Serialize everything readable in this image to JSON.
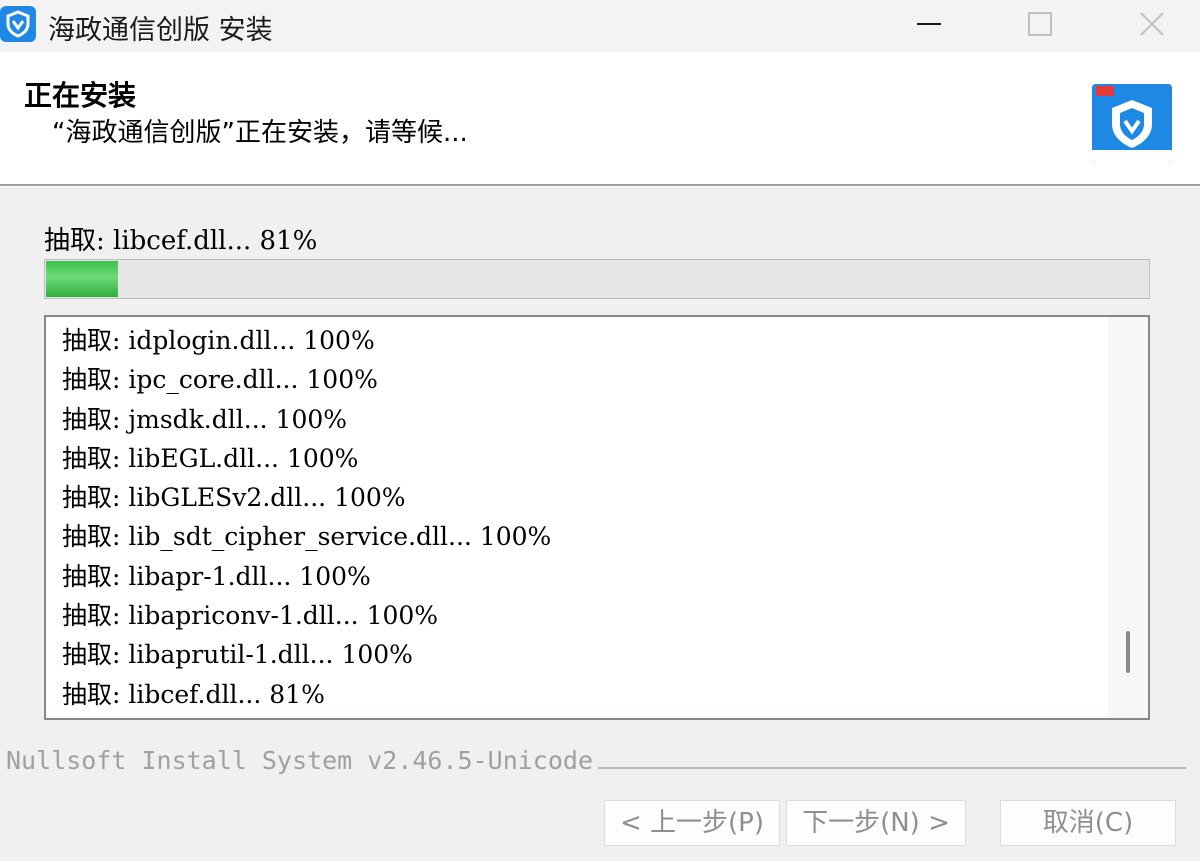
{
  "window": {
    "title": "海政通信创版 安装",
    "icons": {
      "app": "shield-logo-icon",
      "minimize": "minimize-icon",
      "maximize": "maximize-icon",
      "close": "close-icon"
    }
  },
  "header": {
    "title": "正在安装",
    "subtitle": "“海政通信创版”正在安装，请等候...",
    "logo": "haizhengtong-logo-icon"
  },
  "progress": {
    "status_text": "抽取: libcef.dll... 81%",
    "fraction": 0.065,
    "fill_color": "#3cc14a"
  },
  "log": {
    "lines": [
      "抽取: idplogin.dll... 100%",
      "抽取: ipc_core.dll... 100%",
      "抽取: jmsdk.dll... 100%",
      "抽取: libEGL.dll... 100%",
      "抽取: libGLESv2.dll... 100%",
      "抽取: lib_sdt_cipher_service.dll... 100%",
      "抽取: libapr-1.dll... 100%",
      "抽取: libapriconv-1.dll... 100%",
      "抽取: libaprutil-1.dll... 100%",
      "抽取: libcef.dll... 81%"
    ]
  },
  "footer": {
    "branding": "Nullsoft Install System v2.46.5-Unicode",
    "buttons": {
      "back": "< 上一步(P)",
      "next": "下一步(N) >",
      "cancel": "取消(C)"
    }
  },
  "colors": {
    "accent": "#1e88e5",
    "progress": "#3cc14a"
  }
}
